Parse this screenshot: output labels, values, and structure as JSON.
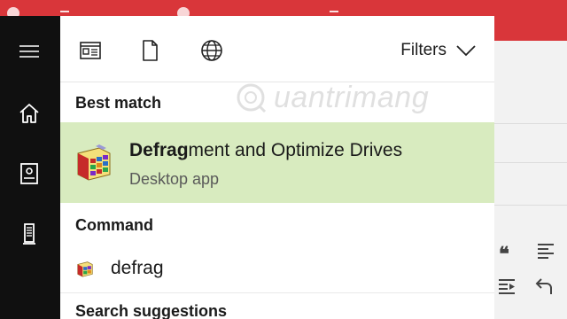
{
  "rail": {
    "items": [
      {
        "icon": "hamburger-menu-icon"
      },
      {
        "icon": "home-icon"
      },
      {
        "icon": "notebook-icon"
      },
      {
        "icon": "tower-pc-icon"
      }
    ]
  },
  "toolbar": {
    "filter_icons": [
      "apps-filter-icon",
      "documents-filter-icon",
      "web-filter-icon"
    ],
    "filters_label": "Filters"
  },
  "watermark": {
    "text": "uantrimang"
  },
  "best_match": {
    "heading": "Best match",
    "title_bold": "Defrag",
    "title_rest": "ment and Optimize Drives",
    "subtitle": "Desktop app"
  },
  "command": {
    "heading": "Command",
    "item": "defrag"
  },
  "suggestions": {
    "heading": "Search suggestions"
  },
  "colors": {
    "rail_bg": "#101010",
    "highlight_bg": "#d8ebbf",
    "browser_accent": "#d9363a"
  }
}
